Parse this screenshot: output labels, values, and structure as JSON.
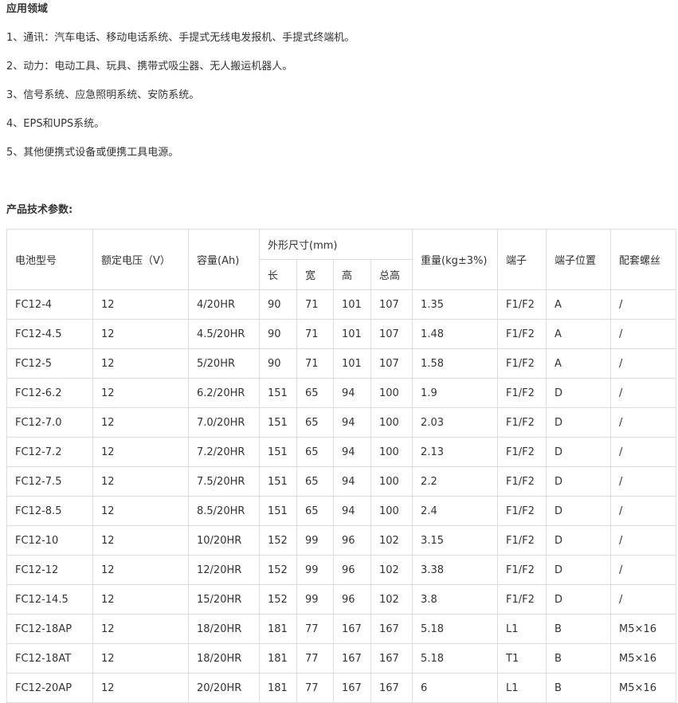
{
  "applications": {
    "title": "应用领域",
    "items": [
      "1、通讯：汽车电话、移动电话系统、手提式无线电发报机、手提式终端机。",
      "2、动力：电动工具、玩具、携带式吸尘器、无人搬运机器人。",
      "3、信号系统、应急照明系统、安防系统。",
      "4、EPS和UPS系统。",
      "5、其他便携式设备或便携工具电源。"
    ]
  },
  "params": {
    "title": "产品技术参数:",
    "headers": {
      "model": "电池型号",
      "voltage": "额定电压（V）",
      "capacity": "容量(Ah)",
      "dimensions": "外形尺寸(mm)",
      "length": "长",
      "width": "宽",
      "height": "高",
      "total_height": "总高",
      "weight": "重量(kg±3%)",
      "terminal": "端子",
      "terminal_position": "端子位置",
      "screw": "配套螺丝"
    },
    "rows": [
      [
        "FC12-4",
        "12",
        "4/20HR",
        "90",
        "71",
        "101",
        "107",
        "1.35",
        "F1/F2",
        "A",
        "/"
      ],
      [
        "FC12-4.5",
        "12",
        "4.5/20HR",
        "90",
        "71",
        "101",
        "107",
        "1.48",
        "F1/F2",
        "A",
        "/"
      ],
      [
        "FC12-5",
        "12",
        "5/20HR",
        "90",
        "71",
        "101",
        "107",
        "1.58",
        "F1/F2",
        "A",
        "/"
      ],
      [
        "FC12-6.2",
        "12",
        "6.2/20HR",
        "151",
        "65",
        "94",
        "100",
        "1.9",
        "F1/F2",
        "D",
        "/"
      ],
      [
        "FC12-7.0",
        "12",
        "7.0/20HR",
        "151",
        "65",
        "94",
        "100",
        "2.03",
        "F1/F2",
        "D",
        "/"
      ],
      [
        "FC12-7.2",
        "12",
        "7.2/20HR",
        "151",
        "65",
        "94",
        "100",
        "2.13",
        "F1/F2",
        "D",
        "/"
      ],
      [
        "FC12-7.5",
        "12",
        "7.5/20HR",
        "151",
        "65",
        "94",
        "100",
        "2.2",
        "F1/F2",
        "D",
        "/"
      ],
      [
        "FC12-8.5",
        "12",
        "8.5/20HR",
        "151",
        "65",
        "94",
        "100",
        "2.4",
        "F1/F2",
        "D",
        "/"
      ],
      [
        "FC12-10",
        "12",
        "10/20HR",
        "152",
        "99",
        "96",
        "102",
        "3.15",
        "F1/F2",
        "D",
        "/"
      ],
      [
        "FC12-12",
        "12",
        "12/20HR",
        "152",
        "99",
        "96",
        "102",
        "3.38",
        "F1/F2",
        "D",
        "/"
      ],
      [
        "FC12-14.5",
        "12",
        "15/20HR",
        "152",
        "99",
        "96",
        "102",
        "3.8",
        "F1/F2",
        "D",
        "/"
      ],
      [
        "FC12-18AP",
        "12",
        "18/20HR",
        "181",
        "77",
        "167",
        "167",
        "5.18",
        "L1",
        "B",
        "M5×16"
      ],
      [
        "FC12-18AT",
        "12",
        "18/20HR",
        "181",
        "77",
        "167",
        "167",
        "5.18",
        "T1",
        "B",
        "M5×16"
      ],
      [
        "FC12-20AP",
        "12",
        "20/20HR",
        "181",
        "77",
        "167",
        "167",
        "6",
        "L1",
        "B",
        "M5×16"
      ]
    ]
  }
}
